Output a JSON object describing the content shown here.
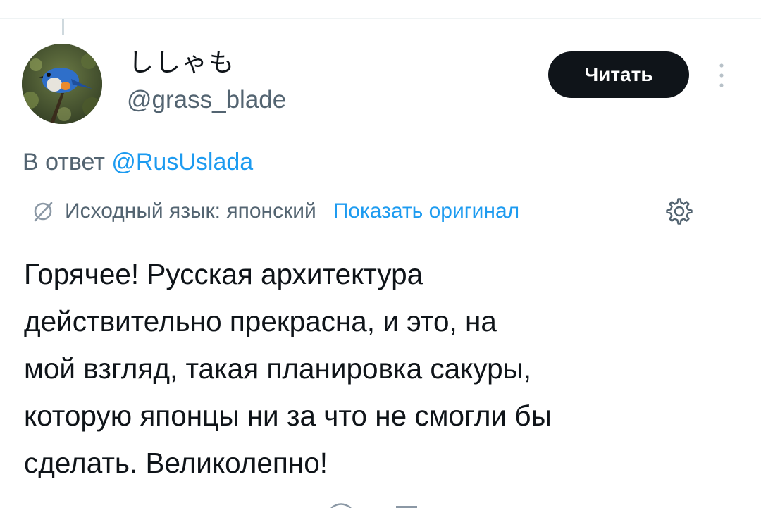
{
  "tweet": {
    "display_name": "ししゃも",
    "handle": "@grass_blade",
    "follow_label": "Читать",
    "reply": {
      "prefix": "В ответ",
      "mention": "@RusUslada"
    },
    "translation": {
      "source_label": "Исходный язык: японский",
      "show_original_label": "Показать оригинал"
    },
    "text": "Горячее! Русская архитектура\nдействительно прекрасна, и это, на\nмой взгляд, такая планировка сакуры,\nкоторую японцы ни за что не смогли бы\nсделать. Великолепно!"
  },
  "icons": {
    "more": "more-vertical-icon",
    "translate": "translate-icon",
    "settings": "gear-icon"
  },
  "colors": {
    "accent": "#1d9bf0",
    "text_primary": "#0f1419",
    "text_secondary": "#536471",
    "button_bg": "#0f1419"
  }
}
